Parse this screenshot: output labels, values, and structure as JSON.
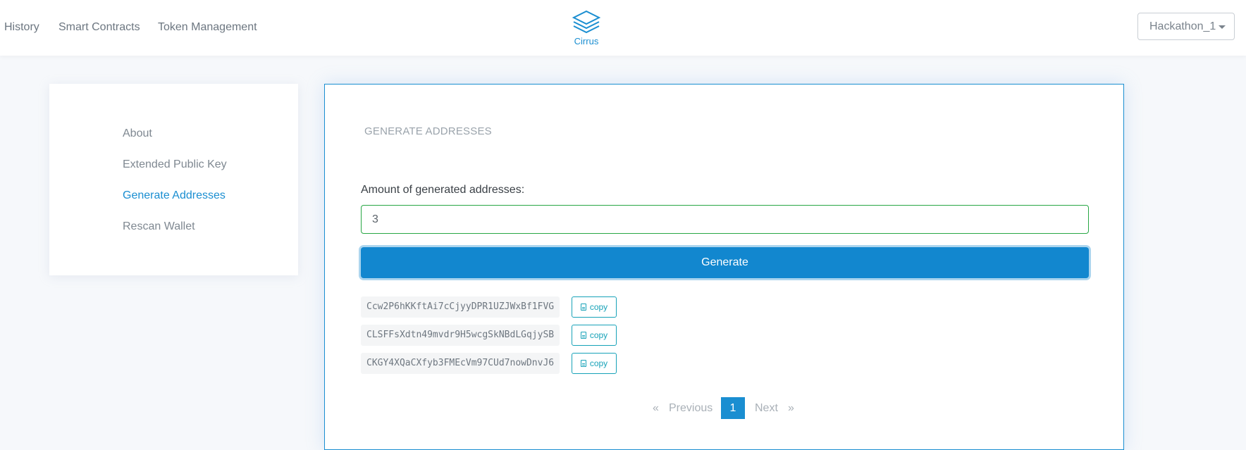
{
  "nav": {
    "links": [
      "History",
      "Smart Contracts",
      "Token Management"
    ],
    "logo_text": "Cirrus",
    "wallet_name": "Hackathon_1"
  },
  "sidebar": {
    "items": [
      {
        "label": "About",
        "active": false
      },
      {
        "label": "Extended Public Key",
        "active": false
      },
      {
        "label": "Generate Addresses",
        "active": true
      },
      {
        "label": "Rescan Wallet",
        "active": false
      }
    ]
  },
  "main": {
    "title": "GENERATE ADDRESSES",
    "amount_label": "Amount of generated addresses:",
    "amount_value": "3",
    "generate_label": "Generate",
    "copy_label": "copy",
    "addresses": [
      "Ccw2P6hKKftAi7cCjyyDPR1UZJWxBf1FVG",
      "CLSFFsXdtn49mvdr9H5wcgSkNBdLGqjySB",
      "CKGY4XQaCXfyb3FMEcVm97CUd7nowDnvJ6"
    ]
  },
  "pagination": {
    "prev_arrow": "«",
    "previous": "Previous",
    "current": "1",
    "next": "Next",
    "next_arrow": "»"
  },
  "colors": {
    "accent": "#1a8ed1",
    "button": "#1287cf",
    "input_valid": "#28a745",
    "copy": "#17a2b8"
  }
}
